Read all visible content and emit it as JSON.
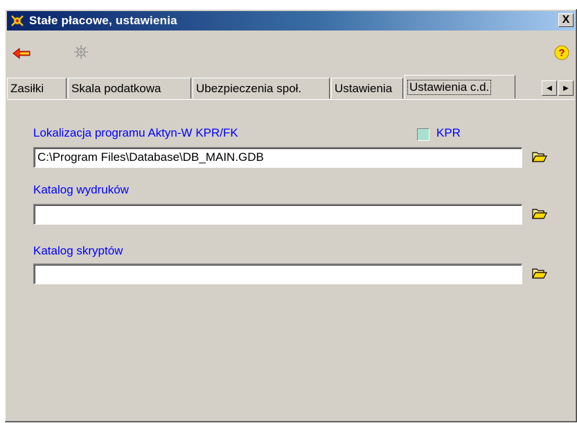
{
  "window": {
    "title": "Stałe płacowe, ustawienia",
    "close_label": "X"
  },
  "toolbar": {
    "back_icon": "arrow-left-icon",
    "tool_icon": "bug-icon",
    "help_icon": "help-icon"
  },
  "tabs": [
    {
      "label": "Zasiłki",
      "active": false
    },
    {
      "label": "Skala podatkowa",
      "active": false
    },
    {
      "label": "Ubezpieczenia społ.",
      "active": false
    },
    {
      "label": "Ustawienia",
      "active": false
    },
    {
      "label": "Ustawienia c.d.",
      "active": true
    }
  ],
  "tab_scroll": {
    "left": "◀",
    "right": "▶"
  },
  "form": {
    "location_label": "Lokalizacja  programu Aktyn-W  KPR/FK",
    "location_value": "C:\\Program Files\\Database\\DB_MAIN.GDB",
    "kpr_label": "KPR",
    "printouts_label": "Katalog wydruków",
    "printouts_value": "",
    "scripts_label": "Katalog skryptów",
    "scripts_value": ""
  },
  "colors": {
    "title_gradient_start": "#0a246a",
    "label_blue": "#0000ff",
    "checkbox_fill": "#a8e0d0"
  }
}
